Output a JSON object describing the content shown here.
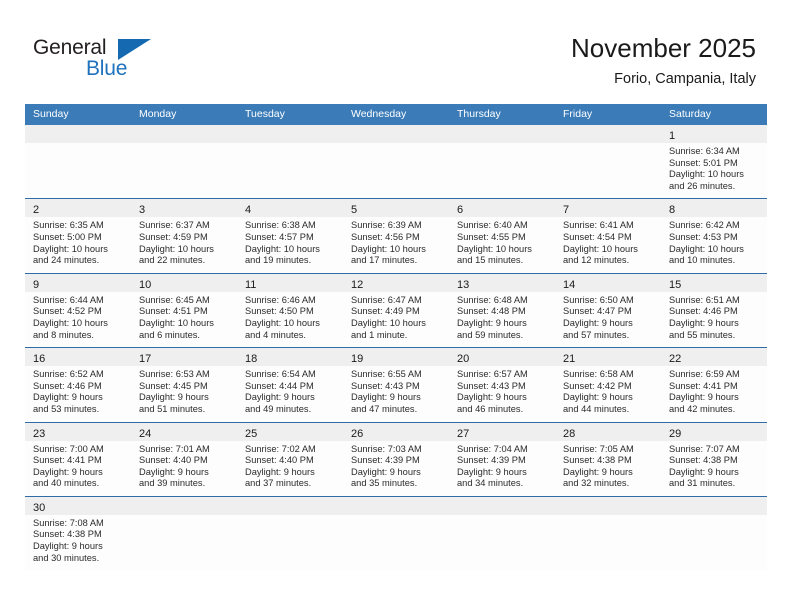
{
  "logo": {
    "word_top": "General",
    "word_bottom": "Blue",
    "accent_color": "#1569b0"
  },
  "header": {
    "title": "November 2025",
    "subtitle": "Forio, Campania, Italy"
  },
  "theme": {
    "header_bar_color": "#3b7cb8",
    "row_divider_color": "#2f6da9",
    "day_band_color": "#efefef",
    "cell_background": "#fdfdfd"
  },
  "weekdays": [
    "Sunday",
    "Monday",
    "Tuesday",
    "Wednesday",
    "Thursday",
    "Friday",
    "Saturday"
  ],
  "weeks": [
    [
      {
        "empty": true
      },
      {
        "empty": true
      },
      {
        "empty": true
      },
      {
        "empty": true
      },
      {
        "empty": true
      },
      {
        "empty": true
      },
      {
        "day": "1",
        "sunrise": "Sunrise: 6:34 AM",
        "sunset": "Sunset: 5:01 PM",
        "daylight_1": "Daylight: 10 hours",
        "daylight_2": "and 26 minutes."
      }
    ],
    [
      {
        "day": "2",
        "sunrise": "Sunrise: 6:35 AM",
        "sunset": "Sunset: 5:00 PM",
        "daylight_1": "Daylight: 10 hours",
        "daylight_2": "and 24 minutes."
      },
      {
        "day": "3",
        "sunrise": "Sunrise: 6:37 AM",
        "sunset": "Sunset: 4:59 PM",
        "daylight_1": "Daylight: 10 hours",
        "daylight_2": "and 22 minutes."
      },
      {
        "day": "4",
        "sunrise": "Sunrise: 6:38 AM",
        "sunset": "Sunset: 4:57 PM",
        "daylight_1": "Daylight: 10 hours",
        "daylight_2": "and 19 minutes."
      },
      {
        "day": "5",
        "sunrise": "Sunrise: 6:39 AM",
        "sunset": "Sunset: 4:56 PM",
        "daylight_1": "Daylight: 10 hours",
        "daylight_2": "and 17 minutes."
      },
      {
        "day": "6",
        "sunrise": "Sunrise: 6:40 AM",
        "sunset": "Sunset: 4:55 PM",
        "daylight_1": "Daylight: 10 hours",
        "daylight_2": "and 15 minutes."
      },
      {
        "day": "7",
        "sunrise": "Sunrise: 6:41 AM",
        "sunset": "Sunset: 4:54 PM",
        "daylight_1": "Daylight: 10 hours",
        "daylight_2": "and 12 minutes."
      },
      {
        "day": "8",
        "sunrise": "Sunrise: 6:42 AM",
        "sunset": "Sunset: 4:53 PM",
        "daylight_1": "Daylight: 10 hours",
        "daylight_2": "and 10 minutes."
      }
    ],
    [
      {
        "day": "9",
        "sunrise": "Sunrise: 6:44 AM",
        "sunset": "Sunset: 4:52 PM",
        "daylight_1": "Daylight: 10 hours",
        "daylight_2": "and 8 minutes."
      },
      {
        "day": "10",
        "sunrise": "Sunrise: 6:45 AM",
        "sunset": "Sunset: 4:51 PM",
        "daylight_1": "Daylight: 10 hours",
        "daylight_2": "and 6 minutes."
      },
      {
        "day": "11",
        "sunrise": "Sunrise: 6:46 AM",
        "sunset": "Sunset: 4:50 PM",
        "daylight_1": "Daylight: 10 hours",
        "daylight_2": "and 4 minutes."
      },
      {
        "day": "12",
        "sunrise": "Sunrise: 6:47 AM",
        "sunset": "Sunset: 4:49 PM",
        "daylight_1": "Daylight: 10 hours",
        "daylight_2": "and 1 minute."
      },
      {
        "day": "13",
        "sunrise": "Sunrise: 6:48 AM",
        "sunset": "Sunset: 4:48 PM",
        "daylight_1": "Daylight: 9 hours",
        "daylight_2": "and 59 minutes."
      },
      {
        "day": "14",
        "sunrise": "Sunrise: 6:50 AM",
        "sunset": "Sunset: 4:47 PM",
        "daylight_1": "Daylight: 9 hours",
        "daylight_2": "and 57 minutes."
      },
      {
        "day": "15",
        "sunrise": "Sunrise: 6:51 AM",
        "sunset": "Sunset: 4:46 PM",
        "daylight_1": "Daylight: 9 hours",
        "daylight_2": "and 55 minutes."
      }
    ],
    [
      {
        "day": "16",
        "sunrise": "Sunrise: 6:52 AM",
        "sunset": "Sunset: 4:46 PM",
        "daylight_1": "Daylight: 9 hours",
        "daylight_2": "and 53 minutes."
      },
      {
        "day": "17",
        "sunrise": "Sunrise: 6:53 AM",
        "sunset": "Sunset: 4:45 PM",
        "daylight_1": "Daylight: 9 hours",
        "daylight_2": "and 51 minutes."
      },
      {
        "day": "18",
        "sunrise": "Sunrise: 6:54 AM",
        "sunset": "Sunset: 4:44 PM",
        "daylight_1": "Daylight: 9 hours",
        "daylight_2": "and 49 minutes."
      },
      {
        "day": "19",
        "sunrise": "Sunrise: 6:55 AM",
        "sunset": "Sunset: 4:43 PM",
        "daylight_1": "Daylight: 9 hours",
        "daylight_2": "and 47 minutes."
      },
      {
        "day": "20",
        "sunrise": "Sunrise: 6:57 AM",
        "sunset": "Sunset: 4:43 PM",
        "daylight_1": "Daylight: 9 hours",
        "daylight_2": "and 46 minutes."
      },
      {
        "day": "21",
        "sunrise": "Sunrise: 6:58 AM",
        "sunset": "Sunset: 4:42 PM",
        "daylight_1": "Daylight: 9 hours",
        "daylight_2": "and 44 minutes."
      },
      {
        "day": "22",
        "sunrise": "Sunrise: 6:59 AM",
        "sunset": "Sunset: 4:41 PM",
        "daylight_1": "Daylight: 9 hours",
        "daylight_2": "and 42 minutes."
      }
    ],
    [
      {
        "day": "23",
        "sunrise": "Sunrise: 7:00 AM",
        "sunset": "Sunset: 4:41 PM",
        "daylight_1": "Daylight: 9 hours",
        "daylight_2": "and 40 minutes."
      },
      {
        "day": "24",
        "sunrise": "Sunrise: 7:01 AM",
        "sunset": "Sunset: 4:40 PM",
        "daylight_1": "Daylight: 9 hours",
        "daylight_2": "and 39 minutes."
      },
      {
        "day": "25",
        "sunrise": "Sunrise: 7:02 AM",
        "sunset": "Sunset: 4:40 PM",
        "daylight_1": "Daylight: 9 hours",
        "daylight_2": "and 37 minutes."
      },
      {
        "day": "26",
        "sunrise": "Sunrise: 7:03 AM",
        "sunset": "Sunset: 4:39 PM",
        "daylight_1": "Daylight: 9 hours",
        "daylight_2": "and 35 minutes."
      },
      {
        "day": "27",
        "sunrise": "Sunrise: 7:04 AM",
        "sunset": "Sunset: 4:39 PM",
        "daylight_1": "Daylight: 9 hours",
        "daylight_2": "and 34 minutes."
      },
      {
        "day": "28",
        "sunrise": "Sunrise: 7:05 AM",
        "sunset": "Sunset: 4:38 PM",
        "daylight_1": "Daylight: 9 hours",
        "daylight_2": "and 32 minutes."
      },
      {
        "day": "29",
        "sunrise": "Sunrise: 7:07 AM",
        "sunset": "Sunset: 4:38 PM",
        "daylight_1": "Daylight: 9 hours",
        "daylight_2": "and 31 minutes."
      }
    ],
    [
      {
        "day": "30",
        "sunrise": "Sunrise: 7:08 AM",
        "sunset": "Sunset: 4:38 PM",
        "daylight_1": "Daylight: 9 hours",
        "daylight_2": "and 30 minutes."
      },
      {
        "empty": true
      },
      {
        "empty": true
      },
      {
        "empty": true
      },
      {
        "empty": true
      },
      {
        "empty": true
      },
      {
        "empty": true
      }
    ]
  ]
}
